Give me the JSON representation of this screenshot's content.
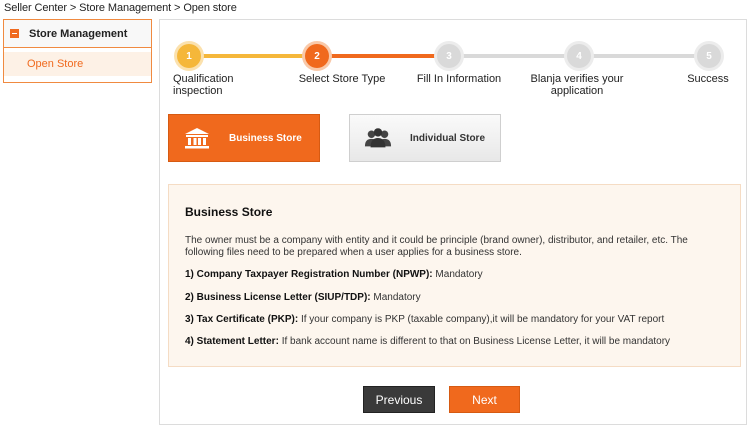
{
  "breadcrumb": "Seller Center > Store Management > Open store",
  "sidebar": {
    "section_label": "Store Management",
    "items": [
      {
        "label": "Open Store"
      }
    ]
  },
  "steps": [
    {
      "number": "1",
      "label": "Qualification inspection",
      "state": "done"
    },
    {
      "number": "2",
      "label": "Select Store Type",
      "state": "current"
    },
    {
      "number": "3",
      "label": "Fill In Information",
      "state": "pending"
    },
    {
      "number": "4",
      "label": "Blanja verifies your application",
      "state": "pending"
    },
    {
      "number": "5",
      "label": "Success",
      "state": "pending"
    }
  ],
  "store_types": {
    "business_label": "Business Store",
    "individual_label": "Individual Store"
  },
  "info": {
    "title": "Business Store",
    "description": "The owner must be a company with entity and it could be principle (brand owner), distributor, and retailer, etc. The following files need to be prepared when a user applies for a business store.",
    "requirements": [
      {
        "label": "1) Company Taxpayer Registration Number (NPWP):",
        "value": "Mandatory"
      },
      {
        "label": "2) Business License Letter (SIUP/TDP):",
        "value": "Mandatory"
      },
      {
        "label": "3) Tax Certificate (PKP):",
        "value": "If your company is PKP (taxable company),it will be mandatory for your VAT report"
      },
      {
        "label": "4) Statement Letter:",
        "value": "If bank account name is different to that on Business License Letter, it will be mandatory"
      }
    ]
  },
  "buttons": {
    "previous": "Previous",
    "next": "Next"
  },
  "colors": {
    "accent": "#f0691d",
    "step_done": "#f5b73a",
    "step_pending": "#d9d9d9",
    "dark_button": "#3a3a3a"
  }
}
